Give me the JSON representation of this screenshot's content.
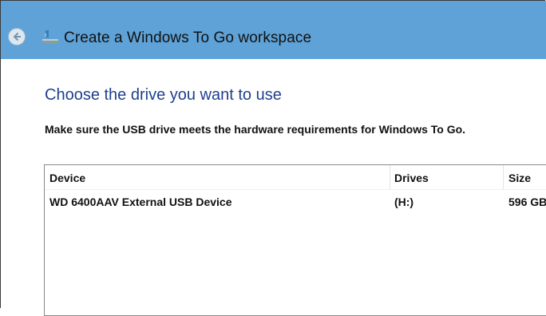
{
  "window": {
    "title": "Create a Windows To Go workspace",
    "back_icon": "back-arrow-icon",
    "app_icon": "usb-drive-icon"
  },
  "page": {
    "heading": "Choose the drive you want to use",
    "instruction": "Make sure the USB drive meets the hardware requirements for Windows To Go."
  },
  "device_list": {
    "columns": [
      "Device",
      "Drives",
      "Size"
    ],
    "rows": [
      {
        "device": "WD 6400AAV External USB Device",
        "drives": "(H:)",
        "size": "596 GB"
      }
    ]
  },
  "colors": {
    "titlebar": "#5ea2d7",
    "heading": "#1f3f8f"
  }
}
